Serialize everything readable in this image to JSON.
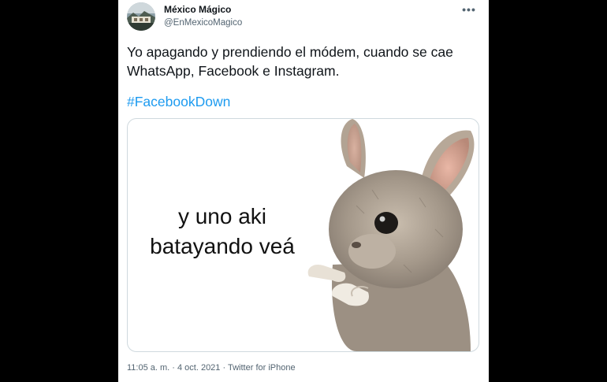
{
  "tweet": {
    "display_name": "México Mágico",
    "handle": "@EnMexicoMagico",
    "more_icon": "more-horizontal-icon",
    "text": "Yo apagando y prendiendo el módem, cuando se cae WhatsApp, Facebook e Instagram.",
    "hashtag": "#FacebookDown",
    "media": {
      "caption_line1": "y uno aki",
      "caption_line2": "batayando veá"
    },
    "timestamp": "11:05 a. m. · 4 oct. 2021 · Twitter for iPhone"
  },
  "colors": {
    "background": "#000000",
    "card": "#ffffff",
    "link": "#1d9bf0",
    "secondary_text": "#536471"
  }
}
